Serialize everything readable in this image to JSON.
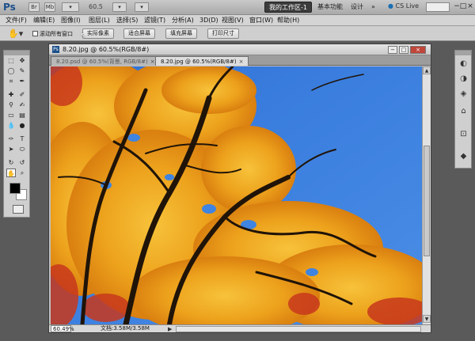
{
  "titlebar": {
    "logo": "Ps",
    "bridge_icon": "Br",
    "minibridge_icon": "Mb",
    "zoom_value": "60.5",
    "workspace_active": "我的工作区-1",
    "workspace_essentials": "基本功能",
    "workspace_design": "设计",
    "more_workspaces": "»",
    "cs_live": "CS Live",
    "win_minimize": "−",
    "win_restore": "□",
    "win_close": "×"
  },
  "menu": {
    "items": [
      "文件(F)",
      "编辑(E)",
      "图像(I)",
      "图层(L)",
      "选择(S)",
      "滤镜(T)",
      "分析(A)",
      "3D(D)",
      "视图(V)",
      "窗口(W)",
      "帮助(H)"
    ]
  },
  "options_bar": {
    "tool_icon": "hand-tool-icon",
    "scroll_all_windows": "滚动所有窗口",
    "buttons": [
      "实际像素",
      "适合屏幕",
      "填充屏幕",
      "打印尺寸"
    ]
  },
  "document": {
    "window_title": "8.20.jpg @ 60.5%(RGB/8#)",
    "tabs": [
      {
        "label": "8.20.psd @ 60.5%(背景, RGB/8#)",
        "active": false
      },
      {
        "label": "8.20.jpg @ 60.5%(RGB/8#)",
        "active": true
      }
    ],
    "tab_close": "×",
    "status_zoom": "60.49%",
    "status_doc": "文档:3.58M/3.58M",
    "status_arrow": "▶"
  },
  "colors": {
    "sky": "#3a7fe0",
    "leaves": "#f0a820",
    "leaves_red": "#c8381c",
    "branches": "#201408",
    "foreground": "#000000",
    "background": "#ffffff",
    "chrome": "#cfcfcf"
  },
  "icons": {
    "scroll_up": "▲",
    "scroll_down": "▼",
    "mask_mode": "quick-mask-icon"
  }
}
